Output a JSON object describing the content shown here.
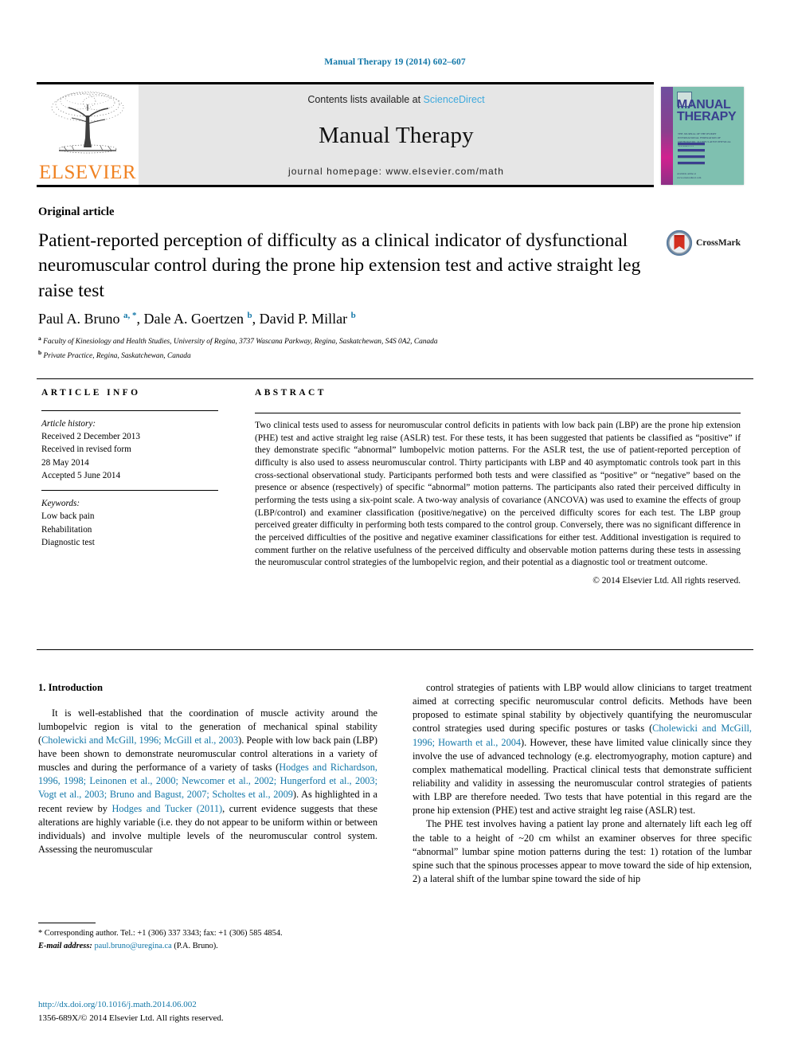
{
  "running_head": "Manual Therapy 19 (2014) 602–607",
  "masthead": {
    "contents_prefix": "Contents lists available at ",
    "sciencedirect": "ScienceDirect",
    "journal_name": "Manual Therapy",
    "homepage": "journal homepage: www.elsevier.com/math",
    "publisher_wordmark": "ELSEVIER"
  },
  "cover": {
    "line1": "MANUAL",
    "line2": "THERAPY",
    "subtitle": "THE JOURNAL OF THE IFOMPT INTERNATIONAL FEDERATION OF ORTHOPAEDIC MANIPULATIVE PHYSICAL THERAPISTS",
    "footer": "Available online at www.sciencedirect.com"
  },
  "article": {
    "type": "Original article",
    "title": "Patient-reported perception of difficulty as a clinical indicator of dysfunctional neuromuscular control during the prone hip extension test and active straight leg raise test",
    "crossmark_label": "CrossMark",
    "authors_html": "Paul A. Bruno <sup>a, *</sup>, Dale A. Goertzen <sup>b</sup>, David P. Millar <sup>b</sup>",
    "affiliation_a": "Faculty of Kinesiology and Health Studies, University of Regina, 3737 Wascana Parkway, Regina, Saskatchewan, S4S 0A2, Canada",
    "affiliation_b": "Private Practice, Regina, Saskatchewan, Canada"
  },
  "headers": {
    "article_info": "ARTICLE INFO",
    "abstract": "ABSTRACT"
  },
  "article_info": {
    "history_label": "Article history:",
    "received": "Received 2 December 2013",
    "revised_label": "Received in revised form",
    "revised_date": "28 May 2014",
    "accepted": "Accepted 5 June 2014",
    "keywords_label": "Keywords:",
    "keywords": [
      "Low back pain",
      "Rehabilitation",
      "Diagnostic test"
    ]
  },
  "abstract": {
    "text": "Two clinical tests used to assess for neuromuscular control deficits in patients with low back pain (LBP) are the prone hip extension (PHE) test and active straight leg raise (ASLR) test. For these tests, it has been suggested that patients be classified as “positive” if they demonstrate specific “abnormal” lumbopelvic motion patterns. For the ASLR test, the use of patient-reported perception of difficulty is also used to assess neuromuscular control. Thirty participants with LBP and 40 asymptomatic controls took part in this cross-sectional observational study. Participants performed both tests and were classified as “positive” or “negative” based on the presence or absence (respectively) of specific “abnormal” motion patterns. The participants also rated their perceived difficulty in performing the tests using a six-point scale. A two-way analysis of covariance (ANCOVA) was used to examine the effects of group (LBP/control) and examiner classification (positive/negative) on the perceived difficulty scores for each test. The LBP group perceived greater difficulty in performing both tests compared to the control group. Conversely, there was no significant difference in the perceived difficulties of the positive and negative examiner classifications for either test. Additional investigation is required to comment further on the relative usefulness of the perceived difficulty and observable motion patterns during these tests in assessing the neuromuscular control strategies of the lumbopelvic region, and their potential as a diagnostic tool or treatment outcome.",
    "copyright": "© 2014 Elsevier Ltd. All rights reserved."
  },
  "body": {
    "section_number_title": "1. Introduction",
    "left_paragraph_1_parts": [
      {
        "t": "It is well-established that the coordination of muscle activity around the lumbopelvic region is vital to the generation of mechanical spinal stability (",
        "cite": false
      },
      {
        "t": "Cholewicki and McGill, 1996; McGill et al., 2003",
        "cite": true
      },
      {
        "t": "). People with low back pain (LBP) have been shown to demonstrate neuromuscular control alterations in a variety of muscles and during the performance of a variety of tasks (",
        "cite": false
      },
      {
        "t": "Hodges and Richardson, 1996, 1998; Leinonen et al., 2000; Newcomer et al., 2002; Hungerford et al., 2003; Vogt et al., 2003; Bruno and Bagust, 2007; Scholtes et al., 2009",
        "cite": true
      },
      {
        "t": "). As highlighted in a recent review by ",
        "cite": false
      },
      {
        "t": "Hodges and Tucker (2011)",
        "cite": true
      },
      {
        "t": ", current evidence suggests that these alterations are highly variable (i.e. they do not appear to be uniform within or between individuals) and involve multiple levels of the neuromuscular control system. Assessing the neuromuscular",
        "cite": false
      }
    ],
    "right_paragraph_1_parts": [
      {
        "t": "control strategies of patients with LBP would allow clinicians to target treatment aimed at correcting specific neuromuscular control deficits. Methods have been proposed to estimate spinal stability by objectively quantifying the neuromuscular control strategies used during specific postures or tasks (",
        "cite": false
      },
      {
        "t": "Cholewicki and McGill, 1996; Howarth et al., 2004",
        "cite": true
      },
      {
        "t": "). However, these have limited value clinically since they involve the use of advanced technology (e.g. electromyography, motion capture) and complex mathematical modelling. Practical clinical tests that demonstrate sufficient reliability and validity in assessing the neuromuscular control strategies of patients with LBP are therefore needed. Two tests that have potential in this regard are the prone hip extension (PHE) test and active straight leg raise (ASLR) test.",
        "cite": false
      }
    ],
    "right_paragraph_2": "The PHE test involves having a patient lay prone and alternately lift each leg off the table to a height of ~20 cm whilst an examiner observes for three specific “abnormal” lumbar spine motion patterns during the test: 1) rotation of the lumbar spine such that the spinous processes appear to move toward the side of hip extension, 2) a lateral shift of the lumbar spine toward the side of hip"
  },
  "footnote": {
    "corresponding": "* Corresponding author. Tel.: +1 (306) 337 3343; fax: +1 (306) 585 4854.",
    "email_label": "E-mail address:",
    "email": "paul.bruno@uregina.ca",
    "email_owner": "(P.A. Bruno)."
  },
  "doi": {
    "url": "http://dx.doi.org/10.1016/j.math.2014.06.002",
    "issn_line": "1356-689X/© 2014 Elsevier Ltd. All rights reserved."
  },
  "colors": {
    "link_blue": "#1277a8",
    "sciencedirect_blue": "#3fa9dd",
    "elsevier_orange": "#f08222",
    "masthead_grey": "#e6e6e6",
    "cover_teal": "#7fc0b0",
    "cover_magenta": "#d1218f"
  }
}
